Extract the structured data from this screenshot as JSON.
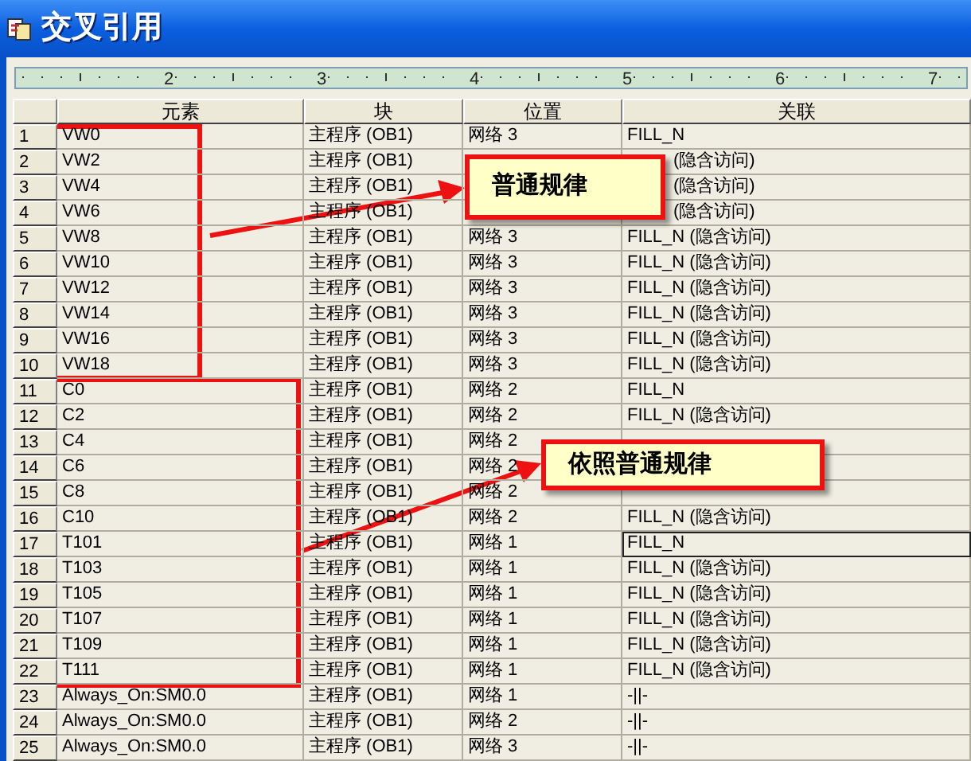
{
  "window": {
    "title": "交叉引用"
  },
  "ruler": {
    "labels": [
      "2",
      "3",
      "4",
      "5",
      "6",
      "7"
    ]
  },
  "table": {
    "columns": [
      "元素",
      "块",
      "位置",
      "关联"
    ],
    "rows": [
      {
        "no": "1",
        "element": "VW0",
        "block": "主程序 (OB1)",
        "position": "网络 3",
        "relation": "FILL_N",
        "selected": false
      },
      {
        "no": "2",
        "element": "VW2",
        "block": "主程序 (OB1)",
        "relation": "(隐含访问)",
        "relation_clipped": true,
        "selected": false
      },
      {
        "no": "3",
        "element": "VW4",
        "block": "主程序 (OB1)",
        "relation": "(隐含访问)",
        "relation_clipped": true,
        "selected": false
      },
      {
        "no": "4",
        "element": "VW6",
        "block": "主程序 (OB1)",
        "relation": "(隐含访问)",
        "relation_clipped": true,
        "selected": false
      },
      {
        "no": "5",
        "element": "VW8",
        "block": "主程序 (OB1)",
        "position": "网络 3",
        "relation": "FILL_N (隐含访问)",
        "selected": false
      },
      {
        "no": "6",
        "element": "VW10",
        "block": "主程序 (OB1)",
        "position": "网络 3",
        "relation": "FILL_N (隐含访问)",
        "selected": false
      },
      {
        "no": "7",
        "element": "VW12",
        "block": "主程序 (OB1)",
        "position": "网络 3",
        "relation": "FILL_N (隐含访问)",
        "selected": false
      },
      {
        "no": "8",
        "element": "VW14",
        "block": "主程序 (OB1)",
        "position": "网络 3",
        "relation": "FILL_N (隐含访问)",
        "selected": false
      },
      {
        "no": "9",
        "element": "VW16",
        "block": "主程序 (OB1)",
        "position": "网络 3",
        "relation": "FILL_N (隐含访问)",
        "selected": false
      },
      {
        "no": "10",
        "element": "VW18",
        "block": "主程序 (OB1)",
        "position": "网络 3",
        "relation": "FILL_N (隐含访问)",
        "selected": false
      },
      {
        "no": "11",
        "element": "C0",
        "block": "主程序 (OB1)",
        "position": "网络 2",
        "relation": "FILL_N",
        "selected": false
      },
      {
        "no": "12",
        "element": "C2",
        "block": "主程序 (OB1)",
        "position": "网络 2",
        "relation": "FILL_N (隐含访问)",
        "selected": false
      },
      {
        "no": "13",
        "element": "C4",
        "block": "主程序 (OB1)",
        "position": "网络 2",
        "selected": false
      },
      {
        "no": "14",
        "element": "C6",
        "block": "主程序 (OB1)",
        "position": "网络 2",
        "selected": false
      },
      {
        "no": "15",
        "element": "C8",
        "block": "主程序 (OB1)",
        "position": "网络 2",
        "selected": false
      },
      {
        "no": "16",
        "element": "C10",
        "block": "主程序 (OB1)",
        "position": "网络 2",
        "relation": "FILL_N (隐含访问)",
        "selected": false
      },
      {
        "no": "17",
        "element": "T101",
        "block": "主程序 (OB1)",
        "position": "网络 1",
        "relation": "FILL_N",
        "selected": true
      },
      {
        "no": "18",
        "element": "T103",
        "block": "主程序 (OB1)",
        "position": "网络 1",
        "relation": "FILL_N (隐含访问)",
        "selected": false
      },
      {
        "no": "19",
        "element": "T105",
        "block": "主程序 (OB1)",
        "position": "网络 1",
        "relation": "FILL_N (隐含访问)",
        "selected": false
      },
      {
        "no": "20",
        "element": "T107",
        "block": "主程序 (OB1)",
        "position": "网络 1",
        "relation": "FILL_N (隐含访问)",
        "selected": false
      },
      {
        "no": "21",
        "element": "T109",
        "block": "主程序 (OB1)",
        "position": "网络 1",
        "relation": "FILL_N (隐含访问)",
        "selected": false
      },
      {
        "no": "22",
        "element": "T111",
        "block": "主程序 (OB1)",
        "position": "网络 1",
        "relation": "FILL_N (隐含访问)",
        "selected": false
      },
      {
        "no": "23",
        "element": "Always_On:SM0.0",
        "block": "主程序 (OB1)",
        "position": "网络 1",
        "relation": "-||-",
        "selected": false
      },
      {
        "no": "24",
        "element": "Always_On:SM0.0",
        "block": "主程序 (OB1)",
        "position": "网络 2",
        "relation": "-||-",
        "selected": false
      },
      {
        "no": "25",
        "element": "Always_On:SM0.0",
        "block": "主程序 (OB1)",
        "position": "网络 3",
        "relation": "-||-",
        "selected": false
      }
    ]
  },
  "callouts": [
    {
      "text": "普通规律"
    },
    {
      "text": "依照普通规律"
    }
  ]
}
